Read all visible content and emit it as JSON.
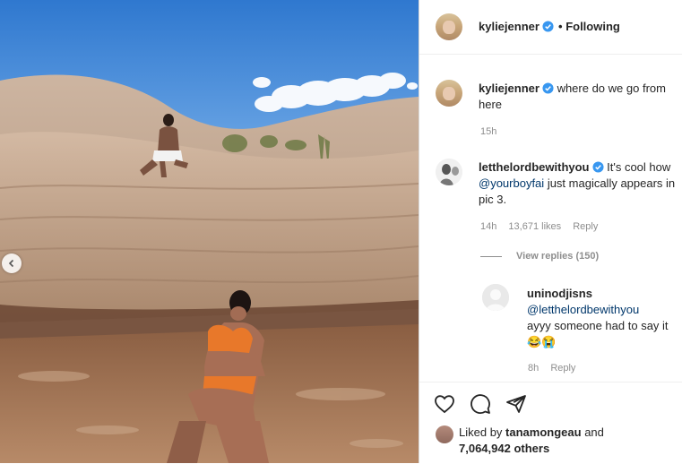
{
  "post": {
    "author": "kyliejenner",
    "follow_status": "Following",
    "separator": "•"
  },
  "caption": {
    "username": "kyliejenner",
    "text": "where do we go from here",
    "time": "15h"
  },
  "comments": [
    {
      "username": "letthelordbewithyou",
      "text_before": "It's cool how",
      "mention": "@yourboyfai",
      "text_after": "just magically appears in pic 3.",
      "time": "14h",
      "likes": "13,671 likes",
      "reply_label": "Reply",
      "view_replies": "View replies (150)"
    },
    {
      "username": "uninodjisns",
      "mention": "@letthelordbewithyou",
      "text": "ayyy someone had to say it 😂😭",
      "time": "8h",
      "reply_label": "Reply"
    }
  ],
  "actions": {
    "like_icon": "heart-icon",
    "comment_icon": "comment-icon",
    "share_icon": "share-icon"
  },
  "likes_summary": {
    "prefix": "Liked by",
    "user": "tanamongeau",
    "connector": "and",
    "others": "7,064,942 others"
  },
  "colors": {
    "verified": "#3897f0",
    "mention": "#00376b",
    "meta": "#8e8e8e",
    "sky": "#3f86d6",
    "bikini": "#e8782a"
  }
}
